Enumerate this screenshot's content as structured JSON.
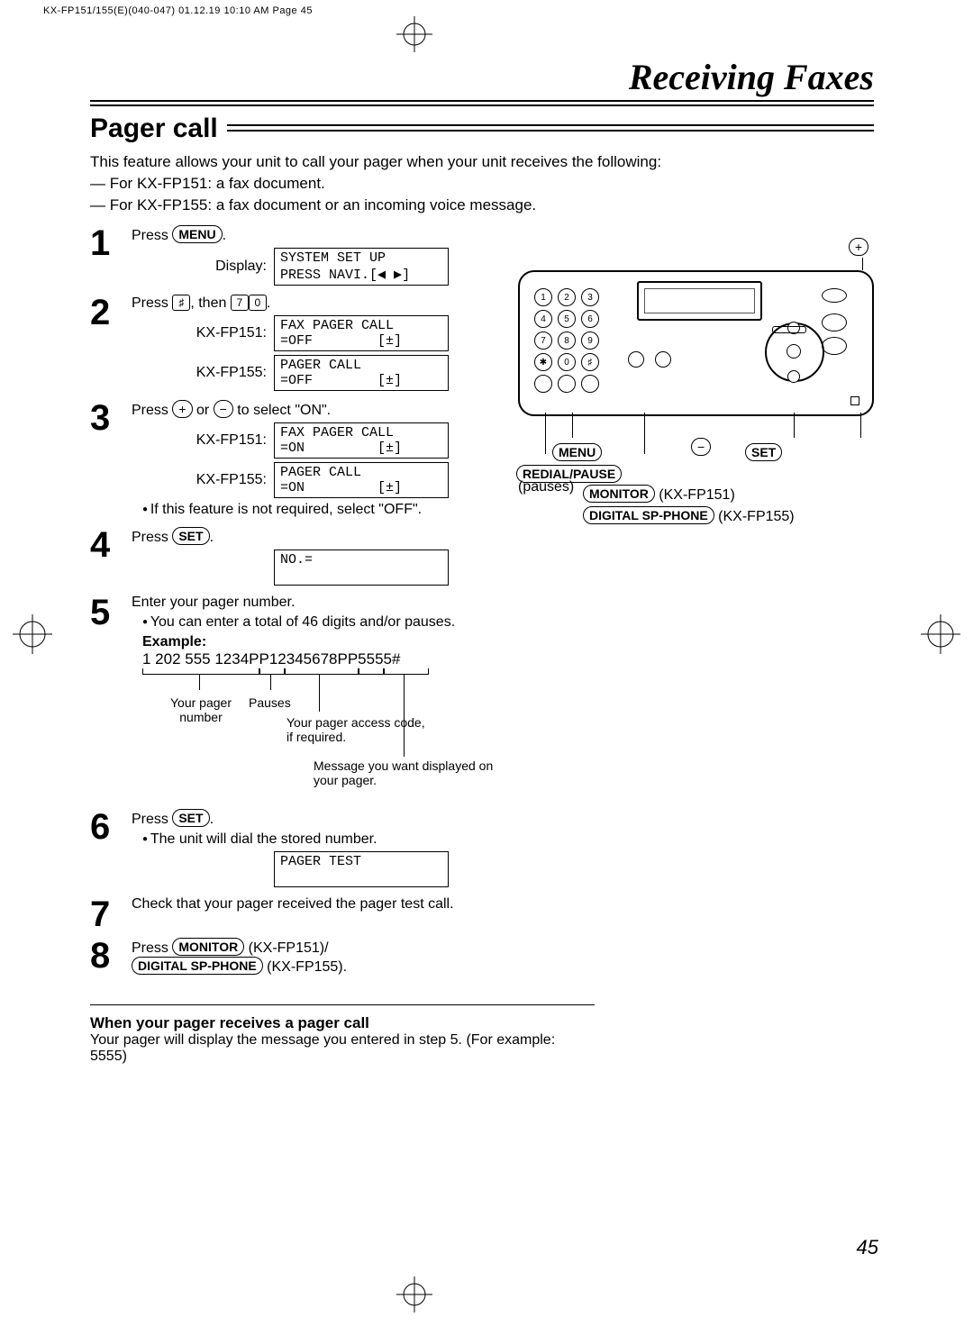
{
  "print_header": "KX-FP151/155(E)(040-047)  01.12.19  10:10 AM  Page 45",
  "chapter_title": "Receiving Faxes",
  "section_title": "Pager call",
  "intro": {
    "line1": "This feature allows your unit to call your pager when your unit receives the following:",
    "line2": "— For KX-FP151: a fax document.",
    "line3": "— For KX-FP155: a fax document or an incoming voice message."
  },
  "buttons": {
    "menu": "MENU",
    "set": "SET",
    "monitor": "MONITOR",
    "digital_sp": "DIGITAL SP-PHONE",
    "redial_pause": "REDIAL/PAUSE",
    "plus": "+",
    "minus": "−"
  },
  "keys": {
    "hash": "♯",
    "seven": "7",
    "zero": "0"
  },
  "steps": {
    "s1": {
      "num": "1",
      "text_press": "Press ",
      "period": ".",
      "disp_label": "Display:",
      "disp": "SYSTEM SET UP\nPRESS NAVI.[◀ ▶]"
    },
    "s2": {
      "num": "2",
      "pre": "Press ",
      "mid": ", then ",
      "after": ".",
      "label151": "KX-FP151:",
      "disp151": "FAX PAGER CALL\n=OFF        [±]",
      "label155": "KX-FP155:",
      "disp155": "PAGER CALL\n=OFF        [±]"
    },
    "s3": {
      "num": "3",
      "pre": "Press ",
      "mid": " or ",
      "after": " to select \"ON\".",
      "label151": "KX-FP151:",
      "disp151": "FAX PAGER CALL\n=ON         [±]",
      "label155": "KX-FP155:",
      "disp155": "PAGER CALL\n=ON         [±]",
      "bullet": "If this feature is not required, select \"OFF\"."
    },
    "s4": {
      "num": "4",
      "pre": "Press ",
      "after": ".",
      "disp": "NO.="
    },
    "s5": {
      "num": "5",
      "line1": "Enter your pager number.",
      "bullet": "You can enter a total of 46 digits and/or pauses.",
      "example_label": "Example:",
      "example": "1 202 555 1234PP12345678PP5555#",
      "ex_a": "Your pager number",
      "ex_b": "Pauses",
      "ex_c": "Your pager access code, if required.",
      "ex_d": "Message you want displayed on your pager."
    },
    "s6": {
      "num": "6",
      "pre": "Press ",
      "after": ".",
      "bullet": "The unit will dial the stored number.",
      "disp": "PAGER TEST"
    },
    "s7": {
      "num": "7",
      "text": "Check that your pager received the pager test call."
    },
    "s8": {
      "num": "8",
      "pre": "Press ",
      "model151": " (KX-FP151)/",
      "model155": " (KX-FP155)."
    }
  },
  "panel": {
    "pauses_label": "(pauses)",
    "model151": " (KX-FP151)",
    "model155": " (KX-FP155)",
    "keypad": [
      "1",
      "2",
      "3",
      "4",
      "5",
      "6",
      "7",
      "8",
      "9",
      "✱",
      "0",
      "♯"
    ]
  },
  "footer": {
    "title": "When your pager receives a pager call",
    "body": "Your pager will display the message you entered in step 5. (For example: 5555)"
  },
  "page_number": "45"
}
